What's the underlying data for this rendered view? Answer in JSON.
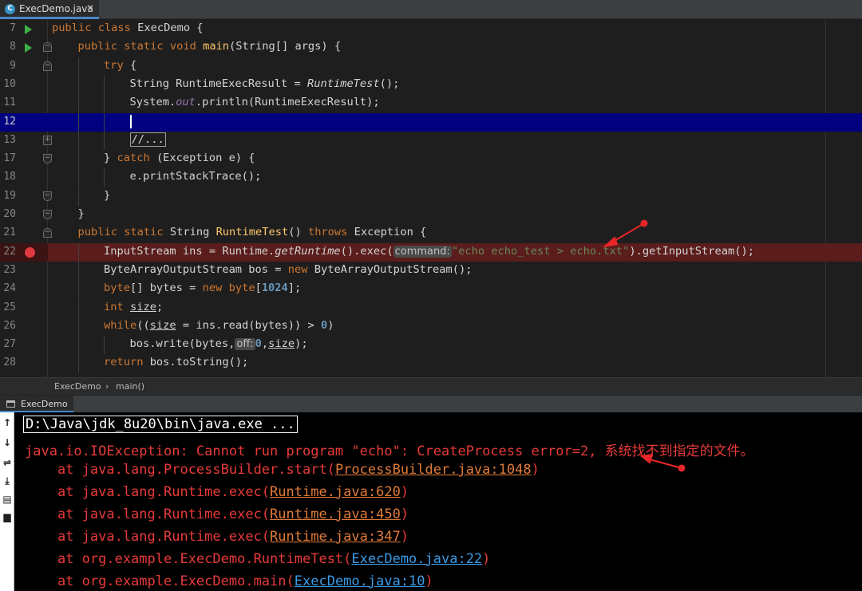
{
  "editor_tab": {
    "label": "ExecDemo.java",
    "close": "✕",
    "icon": "c-class-icon"
  },
  "code_lines": [
    {
      "ln": "7",
      "parts": [
        [
          "kw",
          "public "
        ],
        [
          "kw",
          "class "
        ],
        [
          "txt",
          "ExecDemo {"
        ]
      ]
    },
    {
      "ln": "8",
      "parts": [
        [
          "kw",
          "public "
        ],
        [
          "kw",
          "static "
        ],
        [
          "kw",
          "void "
        ],
        [
          "fn",
          "main"
        ],
        [
          "txt",
          "(String[] args) {"
        ]
      ]
    },
    {
      "ln": "9",
      "parts": [
        [
          "kw",
          "try "
        ],
        [
          "txt",
          "{"
        ]
      ]
    },
    {
      "ln": "10",
      "parts": [
        [
          "txt",
          "String RuntimeExecResult = "
        ],
        [
          "it",
          "RuntimeTest"
        ],
        [
          "txt",
          "();"
        ]
      ]
    },
    {
      "ln": "11",
      "parts": [
        [
          "txt",
          "System."
        ],
        [
          "fld",
          "out"
        ],
        [
          "txt",
          ".println(RuntimeExecResult);"
        ]
      ]
    },
    {
      "ln": "12",
      "parts": []
    },
    {
      "ln": "13",
      "parts": [
        [
          "box",
          "//..."
        ]
      ]
    },
    {
      "ln": "17",
      "parts": [
        [
          "txt",
          "} "
        ],
        [
          "kw",
          "catch "
        ],
        [
          "txt",
          "(Exception e) {"
        ]
      ]
    },
    {
      "ln": "18",
      "parts": [
        [
          "txt",
          "e.printStackTrace();"
        ]
      ]
    },
    {
      "ln": "19",
      "parts": [
        [
          "txt",
          "}"
        ]
      ]
    },
    {
      "ln": "20",
      "parts": [
        [
          "txt",
          "}"
        ]
      ]
    },
    {
      "ln": "21",
      "parts": [
        [
          "kw",
          "public "
        ],
        [
          "kw",
          "static "
        ],
        [
          "txt",
          "String "
        ],
        [
          "fn",
          "RuntimeTest"
        ],
        [
          "txt",
          "() "
        ],
        [
          "kw",
          "throws "
        ],
        [
          "txt",
          "Exception {"
        ]
      ]
    },
    {
      "ln": "22",
      "parts": [
        [
          "txt",
          "InputStream ins = Runtime."
        ],
        [
          "it",
          "getRuntime"
        ],
        [
          "txt",
          "().exec("
        ],
        [
          "hint",
          "command:"
        ],
        [
          "str",
          "\"echo echo_test > echo.txt\""
        ],
        [
          "txt",
          ").getInputStream();"
        ]
      ]
    },
    {
      "ln": "23",
      "parts": [
        [
          "txt",
          "ByteArrayOutputStream bos = "
        ],
        [
          "kw",
          "new "
        ],
        [
          "txt",
          "ByteArrayOutputStream();"
        ]
      ]
    },
    {
      "ln": "24",
      "parts": [
        [
          "kw",
          "byte"
        ],
        [
          "txt",
          "[] bytes = "
        ],
        [
          "kw",
          "new "
        ],
        [
          "kw",
          "byte"
        ],
        [
          "txt",
          "["
        ],
        [
          "num",
          "1024"
        ],
        [
          "txt",
          "];"
        ]
      ]
    },
    {
      "ln": "25",
      "parts": [
        [
          "kw",
          "int "
        ],
        [
          "ul",
          "size"
        ],
        [
          "txt",
          ";"
        ]
      ]
    },
    {
      "ln": "26",
      "parts": [
        [
          "kw",
          "while"
        ],
        [
          "txt",
          "(("
        ],
        [
          "ul",
          "size"
        ],
        [
          "txt",
          " = ins.read(bytes)) > "
        ],
        [
          "num",
          "0"
        ],
        [
          "txt",
          ")"
        ]
      ]
    },
    {
      "ln": "27",
      "parts": [
        [
          "txt",
          "bos.write(bytes,"
        ],
        [
          "hint",
          "off:"
        ],
        [
          "num",
          "0"
        ],
        [
          "txt",
          ","
        ],
        [
          "ul",
          "size"
        ],
        [
          "txt",
          ");"
        ]
      ]
    },
    {
      "ln": "28",
      "parts": [
        [
          "kw",
          "return "
        ],
        [
          "txt",
          "bos.toString();"
        ]
      ]
    }
  ],
  "breadcrumb": {
    "class": "ExecDemo",
    "sep": "›",
    "method": "main()"
  },
  "run_tab": {
    "label": "ExecDemo"
  },
  "console": {
    "command": "D:\\Java\\jdk_8u20\\bin\\java.exe ...",
    "exception": "java.io.IOException: Cannot run program \"echo\": CreateProcess error=2, 系统找不到指定的文件。",
    "frames": [
      {
        "prefix": "    at java.lang.ProcessBuilder.start(",
        "link": "ProcessBuilder.java:1048",
        "suffix": ")",
        "color": "o"
      },
      {
        "prefix": "    at java.lang.Runtime.exec(",
        "link": "Runtime.java:620",
        "suffix": ")",
        "color": "o"
      },
      {
        "prefix": "    at java.lang.Runtime.exec(",
        "link": "Runtime.java:450",
        "suffix": ")",
        "color": "o"
      },
      {
        "prefix": "    at java.lang.Runtime.exec(",
        "link": "Runtime.java:347",
        "suffix": ")",
        "color": "o"
      },
      {
        "prefix": "    at org.example.ExecDemo.RuntimeTest(",
        "link": "ExecDemo.java:22",
        "suffix": ")",
        "color": "b"
      },
      {
        "prefix": "    at org.example.ExecDemo.main(",
        "link": "ExecDemo.java:10",
        "suffix": ")",
        "color": "b"
      }
    ]
  },
  "toolbar_icons": [
    "up-arrow-icon",
    "down-arrow-icon",
    "soft-wrap-icon",
    "scroll-to-end-icon",
    "print-icon",
    "trash-icon"
  ],
  "colors": {
    "keyword": "#cc7832",
    "method": "#ffc66d",
    "string": "#6a8759",
    "number": "#6897bb",
    "error_text": "#e83a3a",
    "current_line": "#000080",
    "breakpoint_line": "#5a1d1b"
  }
}
